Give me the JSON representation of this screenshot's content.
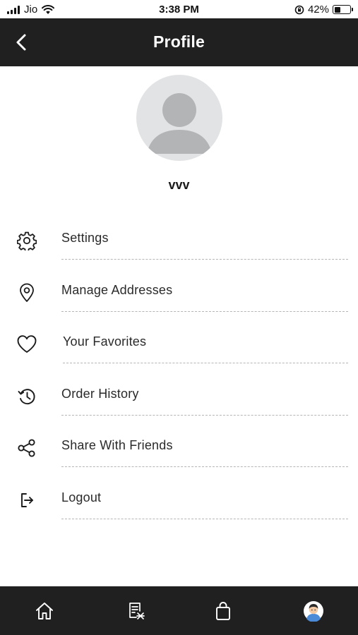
{
  "status_bar": {
    "carrier": "Jio",
    "time": "3:38 PM",
    "battery_percent": "42%",
    "icons": [
      "signal-icon",
      "wifi-icon",
      "orientation-lock-icon",
      "battery-icon"
    ]
  },
  "header": {
    "title": "Profile",
    "back_icon": "chevron-left-icon"
  },
  "profile": {
    "avatar_icon": "user-placeholder-icon",
    "username": "vvv"
  },
  "menu": {
    "items": [
      {
        "label": "Settings",
        "icon": "gear-icon"
      },
      {
        "label": "Manage Addresses",
        "icon": "location-pin-icon"
      },
      {
        "label": "Your Favorites",
        "icon": "heart-icon"
      },
      {
        "label": "Order History",
        "icon": "history-icon"
      },
      {
        "label": "Share With Friends",
        "icon": "share-icon"
      },
      {
        "label": "Logout",
        "icon": "logout-icon"
      }
    ]
  },
  "tab_bar": {
    "tabs": [
      {
        "icon": "home-icon"
      },
      {
        "icon": "receipt-icon"
      },
      {
        "icon": "shopping-bag-icon"
      },
      {
        "icon": "user-avatar-icon"
      }
    ]
  },
  "colors": {
    "header_bg": "#202020",
    "tab_bar_bg": "#202020",
    "avatar_bg": "#e2e3e4",
    "avatar_silhouette": "#b2b4b6",
    "divider": "#b5b5b5"
  }
}
